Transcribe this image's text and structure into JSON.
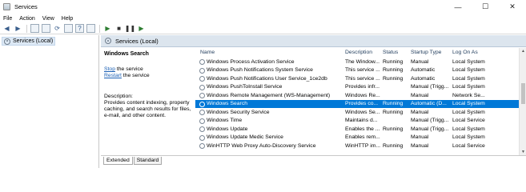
{
  "window": {
    "title": "Services",
    "controls": {
      "minimize": "—",
      "maximize": "☐",
      "close": "✕"
    }
  },
  "menu": [
    "File",
    "Action",
    "View",
    "Help"
  ],
  "toolbar": {
    "icons": [
      "back-arrow-icon",
      "forward-arrow-icon",
      "console-tree-icon",
      "list-view-icon",
      "refresh-icon",
      "export-icon",
      "help-icon",
      "properties-icon",
      "start-service-icon",
      "stop-service-icon",
      "pause-service-icon",
      "restart-service-icon"
    ]
  },
  "tree": {
    "root_label": "Services (Local)"
  },
  "pane": {
    "header_title": "Services (Local)"
  },
  "description": {
    "service_title": "Windows Search",
    "stop_link": "Stop",
    "stop_suffix": " the service",
    "restart_link": "Restart",
    "restart_suffix": " the service",
    "label": "Description:",
    "text": "Provides content indexing, property caching, and search results for files, e-mail, and other content."
  },
  "columns": {
    "name": "Name",
    "description": "Description",
    "status": "Status",
    "startup_type": "Startup Type",
    "log_on_as": "Log On As"
  },
  "services": [
    {
      "name": "Windows Process Activation Service",
      "description": "The Window...",
      "status": "Running",
      "startup": "Manual",
      "logon": "Local System"
    },
    {
      "name": "Windows Push Notifications System Service",
      "description": "This service ...",
      "status": "Running",
      "startup": "Automatic",
      "logon": "Local System"
    },
    {
      "name": "Windows Push Notifications User Service_1ce2db",
      "description": "This service ...",
      "status": "Running",
      "startup": "Automatic",
      "logon": "Local System"
    },
    {
      "name": "Windows PushToInstall Service",
      "description": "Provides infr...",
      "status": "",
      "startup": "Manual (Trigg...",
      "logon": "Local System"
    },
    {
      "name": "Windows Remote Management (WS-Management)",
      "description": "Windows Re...",
      "status": "",
      "startup": "Manual",
      "logon": "Network Se..."
    },
    {
      "name": "Windows Search",
      "description": "Provides co...",
      "status": "Running",
      "startup": "Automatic (D...",
      "logon": "Local System"
    },
    {
      "name": "Windows Security Service",
      "description": "Windows Se...",
      "status": "Running",
      "startup": "Manual",
      "logon": "Local System"
    },
    {
      "name": "Windows Time",
      "description": "Maintains d...",
      "status": "",
      "startup": "Manual (Trigg...",
      "logon": "Local Service"
    },
    {
      "name": "Windows Update",
      "description": "Enables the ...",
      "status": "Running",
      "startup": "Manual (Trigg...",
      "logon": "Local System"
    },
    {
      "name": "Windows Update Medic Service",
      "description": "Enables rem...",
      "status": "",
      "startup": "Manual",
      "logon": "Local System"
    },
    {
      "name": "WinHTTP Web Proxy Auto-Discovery Service",
      "description": "WinHTTP im...",
      "status": "Running",
      "startup": "Manual",
      "logon": "Local Service"
    }
  ],
  "selected_service": "Windows Search",
  "tabs": [
    "Extended",
    "Standard"
  ],
  "active_tab": "Extended",
  "colors": {
    "selection": "#0078d7",
    "header_band": "#dce5ee",
    "link": "#1a5fb4"
  }
}
